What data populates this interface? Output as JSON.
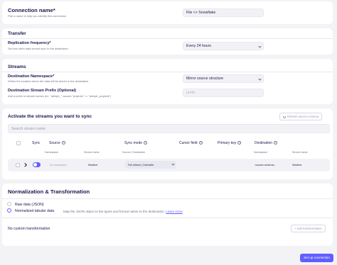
{
  "connection": {
    "title": "Connection name*",
    "hint": "Pick a name to help you identify this connection",
    "value": "File <> Snowflake"
  },
  "transfer": {
    "title": "Transfer",
    "frequency_label": "Replication frequency*",
    "frequency_hint": "Set how often data should sync to the destination",
    "frequency_value": "Every 24 hours"
  },
  "streams": {
    "title": "Streams",
    "namespace_label": "Destination Namespace*",
    "namespace_hint": "Define the location where the data will be stored in the destination",
    "namespace_value": "Mirror source structure",
    "prefix_label": "Destination Stream Prefix (Optional)",
    "prefix_hint": "Add a prefix to stream names (ex. \"airbyte_\" causes \"projects\" => \"airbyte_projects\")",
    "prefix_placeholder": "prefix"
  },
  "activate": {
    "title": "Activate the streams you want to sync",
    "refresh_label": "Refresh source schema",
    "search_placeholder": "Search stream name",
    "columns": {
      "sync": "Sync",
      "source": "Source",
      "sync_mode": "Sync mode",
      "cursor_field": "Cursor field",
      "primary_key": "Primary key",
      "destination": "Destination"
    },
    "subcolumns": {
      "namespace": "Namespace",
      "stream_name": "Stream name",
      "source_destination": "Source | Destination",
      "dest_namespace": "Namespace",
      "dest_stream_name": "Stream name"
    },
    "row": {
      "namespace": "No namespace",
      "stream_name": "Weather",
      "sync_mode": "Full refresh | Overwrite",
      "dest_namespace": "<source schema>",
      "dest_stream_name": "Weather"
    }
  },
  "normalization": {
    "title": "Normalization & Transformation",
    "raw_label": "Raw data (JSON)",
    "normalized_label": "Normalized tabular data",
    "normalized_hint": "Map the JSON object to the types and format native to the destination.",
    "learn_more": "Learn more",
    "no_transform": "No custom transformation",
    "add_transform": "+ Add transformation"
  },
  "footer": {
    "setup_button": "Set up connection"
  },
  "colors": {
    "accent": "#615eff",
    "text": "#1a194d",
    "muted": "#717189"
  }
}
